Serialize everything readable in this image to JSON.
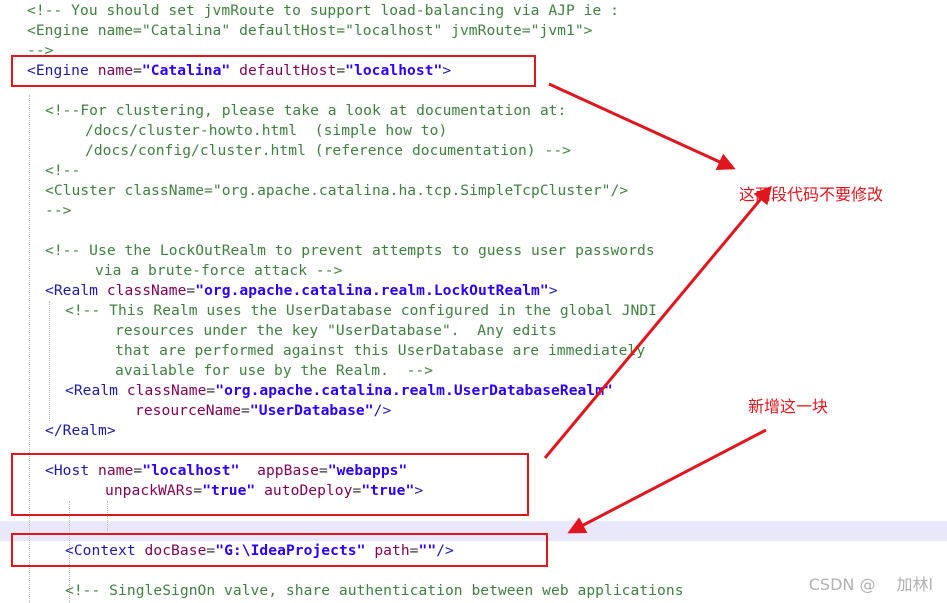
{
  "code": {
    "l1": "<!-- You should set jvmRoute to support load-balancing via AJP ie :",
    "l2": "<Engine name=\"Catalina\" defaultHost=\"localhost\" jvmRoute=\"jvm1\">",
    "l3": "-->",
    "l4": {
      "open": "<Engine",
      "attr1": "name",
      "val1": "\"Catalina\"",
      "attr2": "defaultHost",
      "val2": "\"localhost\"",
      "close": ">"
    },
    "l6": "<!--For clustering, please take a look at documentation at:",
    "l7": "/docs/cluster-howto.html  (simple how to)",
    "l8": "/docs/config/cluster.html (reference documentation) -->",
    "l9": "<!--",
    "l10": "<Cluster className=\"org.apache.catalina.ha.tcp.SimpleTcpCluster\"/>",
    "l11": "-->",
    "l13": "<!-- Use the LockOutRealm to prevent attempts to guess user passwords",
    "l14": "via a brute-force attack -->",
    "l15": {
      "open": "<Realm",
      "attr": "className",
      "val": "\"org.apache.catalina.realm.LockOutRealm\"",
      "close": ">"
    },
    "l16": "<!-- This Realm uses the UserDatabase configured in the global JNDI",
    "l17": "resources under the key \"UserDatabase\".  Any edits",
    "l18": "that are performed against this UserDatabase are immediately",
    "l19": "available for use by the Realm.  -->",
    "l20": {
      "open": "<Realm",
      "attr": "className",
      "val": "\"org.apache.catalina.realm.UserDatabaseRealm\""
    },
    "l21": {
      "attr": "resourceName",
      "val": "\"UserDatabase\"",
      "close": "/>"
    },
    "l22": "</Realm>",
    "l24": {
      "open": "<Host",
      "attr1": "name",
      "val1": "\"localhost\"",
      "attr2": "appBase",
      "val2": "\"webapps\""
    },
    "l25": {
      "attr1": "unpackWARs",
      "val1": "\"true\"",
      "attr2": "autoDeploy",
      "val2": "\"true\"",
      "close": ">"
    },
    "l28": {
      "open": "<Context",
      "attr1": "docBase",
      "val1": "\"G:\\IdeaProjects\"",
      "attr2": "path",
      "val2": "\"\"",
      "close": "/>"
    },
    "l30": "<!-- SingleSignOn valve, share authentication between web applications"
  },
  "annotations": {
    "no_modify": "这两段代码不要修改",
    "add_block": "新增这一块"
  },
  "watermark": "CSDN @　 加林l",
  "colors": {
    "comment": "#3f7f3f",
    "tag": "#1a1aa6",
    "attribute": "#7f0055",
    "value": "#2a00ff",
    "annotation": "#e0161e",
    "current_line": "#e8e8fa"
  }
}
